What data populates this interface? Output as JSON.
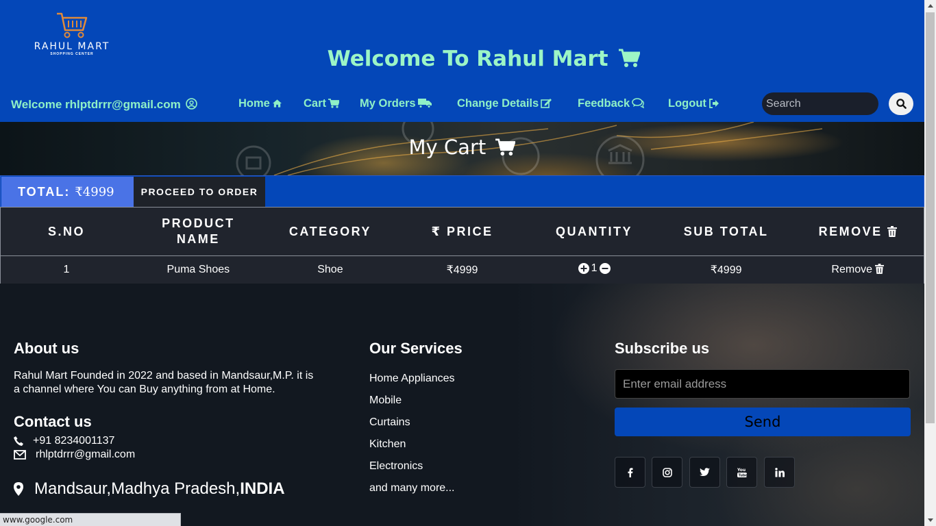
{
  "brand": {
    "name": "RAHUL MART",
    "tagline": "SHOPPING CENTER"
  },
  "header": {
    "title": "Welcome To Rahul Mart"
  },
  "nav": {
    "user_greeting": "Welcome rhlptdrrr@gmail.com",
    "links": [
      {
        "label": "Home",
        "icon": "home-icon"
      },
      {
        "label": "Cart",
        "icon": "cart-icon"
      },
      {
        "label": "My Orders",
        "icon": "truck-icon"
      },
      {
        "label": "Change Details",
        "icon": "edit-icon"
      },
      {
        "label": "Feedback",
        "icon": "comments-icon"
      },
      {
        "label": "Logout",
        "icon": "logout-icon"
      }
    ],
    "search_placeholder": "Search"
  },
  "banner": {
    "title": "My Cart"
  },
  "cart": {
    "total_label": "TOTAL:",
    "total_value": "₹4999",
    "proceed_label": "PROCEED TO ORDER",
    "columns": [
      "S.NO",
      "PRODUCT NAME",
      "CATEGORY",
      "₹ PRICE",
      "QUANTITY",
      "SUB TOTAL",
      "REMOVE"
    ],
    "rows": [
      {
        "sno": "1",
        "product": "Puma Shoes",
        "category": "Shoe",
        "price": "₹4999",
        "quantity": "1",
        "subtotal": "₹4999",
        "remove": "Remove"
      }
    ]
  },
  "footer": {
    "about_title": "About us",
    "about_text": "Rahul Mart Founded in 2022 and based in Mandsaur,M.P. it is a channel where You can Buy anything from at Home.",
    "contact_title": "Contact us",
    "phone": "+91 8234001137",
    "email": "rhlptdrrr@gmail.com",
    "address_prefix": "Mandsaur,Madhya Pradesh,",
    "address_country": "INDIA",
    "services_title": "Our Services",
    "services": [
      "Home Appliances",
      "Mobile",
      "Curtains",
      "Kitchen",
      "Electronics",
      "and many more..."
    ],
    "subscribe_title": "Subscribe us",
    "email_placeholder": "Enter email address",
    "send_label": "Send",
    "social": [
      "facebook-icon",
      "instagram-icon",
      "twitter-icon",
      "youtube-icon",
      "linkedin-icon"
    ]
  },
  "status_bar": {
    "url": "www.google.com"
  },
  "colors": {
    "header_bg": "#0447b8",
    "accent_text": "#9cf5c6",
    "total_bg": "#4a73e6",
    "table_bg": "#20242d"
  }
}
